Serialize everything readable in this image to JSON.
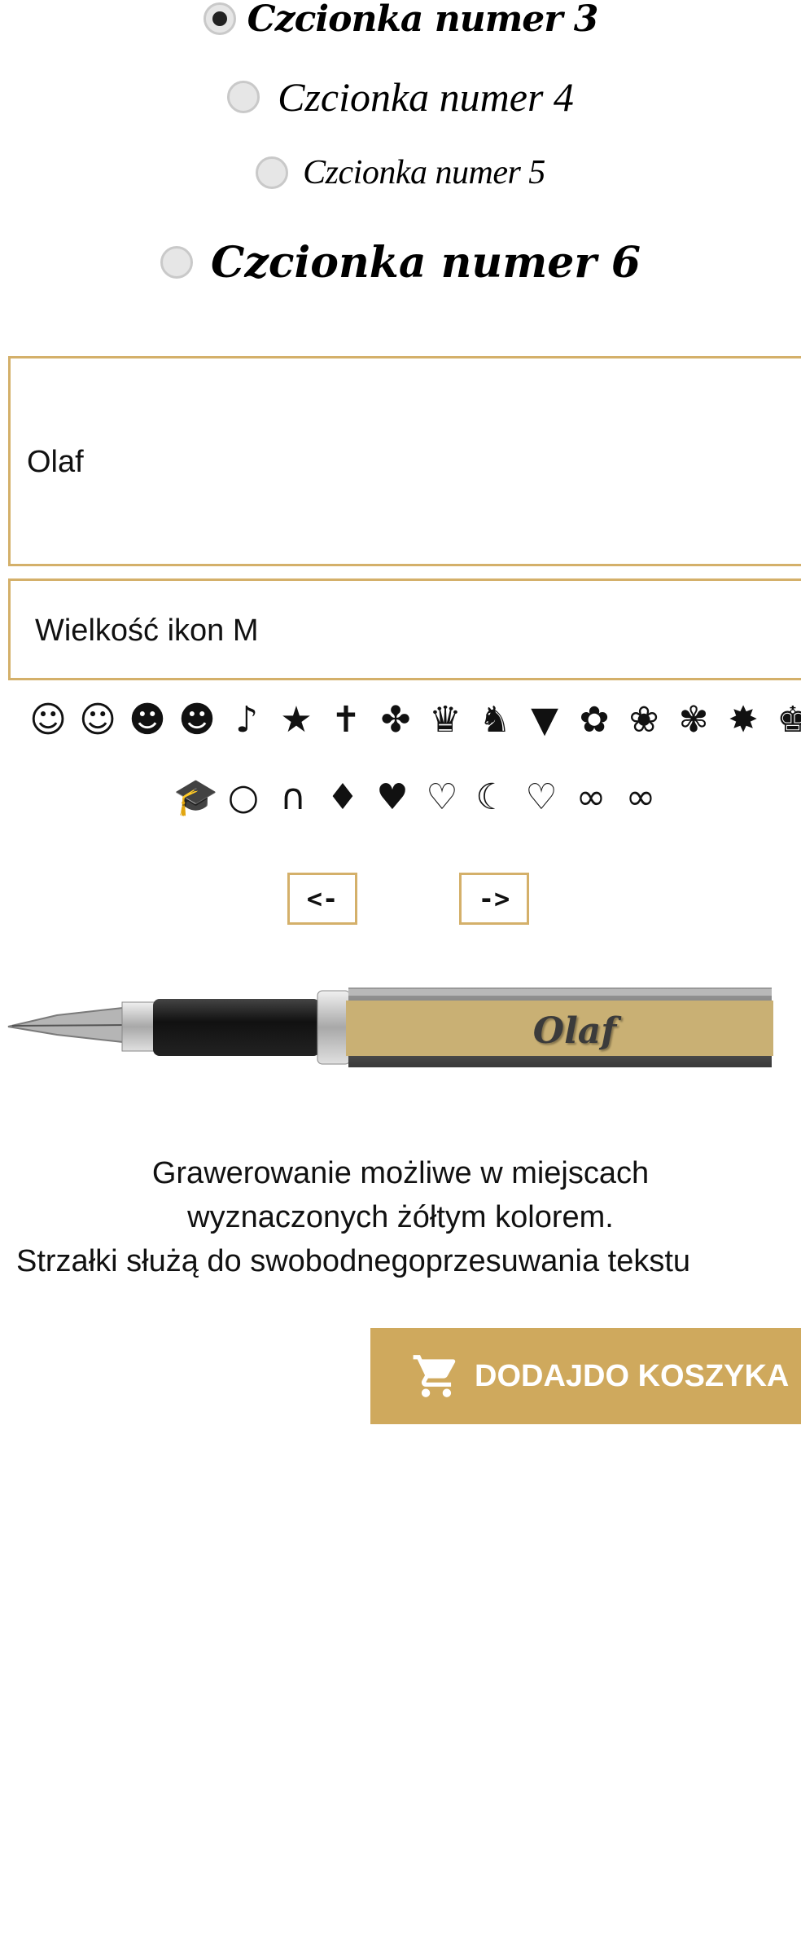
{
  "fonts": [
    {
      "label": "Czcionka numer 3",
      "checked": true
    },
    {
      "label": "Czcionka numer 4",
      "checked": false
    },
    {
      "label": "Czcionka numer 5",
      "checked": false
    },
    {
      "label": "Czcionka numer 6",
      "checked": false
    }
  ],
  "engraving": {
    "text_value": "Olaf"
  },
  "icon_size": {
    "label": "Wielkość ikon M"
  },
  "icons_row1": [
    "☺",
    "☺",
    "☻",
    "☻",
    "♪",
    "★",
    "✝",
    "✤",
    "♛",
    "♞",
    "▼",
    "✿",
    "❀",
    "✾",
    "✸",
    "♚"
  ],
  "icons_row2": [
    "🎓",
    "○",
    "∩",
    "♦",
    "♥",
    "♡",
    "☾",
    "♡",
    "∞",
    "∞"
  ],
  "icon_names_row1": [
    "smiley-icon",
    "smiley-outline-icon",
    "smile-mouth-icon",
    "smile-mouth-2-icon",
    "music-notes-icon",
    "star-icon",
    "ihs-cross-icon",
    "clover-icon",
    "crown-icon",
    "cat-icon",
    "tie-icon",
    "rose-icon",
    "rosebud-icon",
    "paw-icon",
    "medal-icon",
    "grad-cap-icon"
  ],
  "icon_names_row2": [
    "grad-cap-icon",
    "rings-icon",
    "horseshoe-icon",
    "leaf-heart-icon",
    "heart-filled-icon",
    "heart-outline-icon",
    "moon-heart-icon",
    "double-heart-icon",
    "infinity-filled-icon",
    "infinity-outline-icon"
  ],
  "nav": {
    "left_label": "<-",
    "right_label": "->"
  },
  "pen": {
    "engraved_text": "Olaf"
  },
  "info": {
    "line1": "Grawerowanie możliwe w miejscach",
    "line2": "wyznaczonych żółtym kolorem.",
    "line3": "Strzałki służą do swobodnegoprzesuwania tekstu"
  },
  "cart": {
    "label": "DODAJDO KOSZYKA"
  },
  "colors": {
    "accent": "#cfa95d",
    "border": "#d4b06a"
  }
}
